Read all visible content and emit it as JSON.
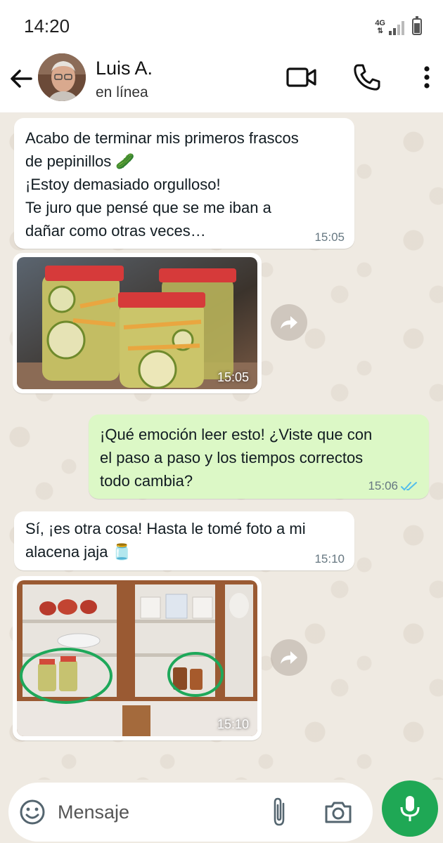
{
  "status_bar": {
    "time": "14:20",
    "network": "4G",
    "signal_bars": 2,
    "battery_level": 0.75
  },
  "header": {
    "contact_name": "Luis A.",
    "contact_status": "en línea",
    "icons": [
      "back-arrow-icon",
      "video-call-icon",
      "phone-icon",
      "more-vert-icon"
    ]
  },
  "messages": [
    {
      "direction": "in",
      "type": "text",
      "text": "Acabo de terminar mis primeros frascos\nde pepinillos 🥒\n¡Estoy demasiado orgulloso!\nTe juro que pensé que se me iban a\ndañar como otras veces…",
      "time": "15:05"
    },
    {
      "direction": "in",
      "type": "image",
      "alt": "pickle-jars-photo",
      "time": "15:05"
    },
    {
      "direction": "out",
      "type": "text",
      "text": "¡Qué emoción leer esto! ¿Viste que con\nel paso a paso y los tiempos correctos\ntodo cambia?",
      "time": "15:06",
      "status": "read"
    },
    {
      "direction": "in",
      "type": "text",
      "text": "Sí, ¡es otra cosa! Hasta le tomé foto a mi\nalacena jaja 🫙",
      "time": "15:10"
    },
    {
      "direction": "in",
      "type": "image",
      "alt": "pantry-cupboard-photo",
      "time": "15:10"
    }
  ],
  "input": {
    "placeholder": "Mensaje",
    "value": ""
  },
  "colors": {
    "accent_green": "#1fa855",
    "outgoing_bubble": "#dcf8c6",
    "chat_background": "#efeae2",
    "read_ticks": "#53bdeb",
    "circle_marker": "#1ea85a"
  }
}
